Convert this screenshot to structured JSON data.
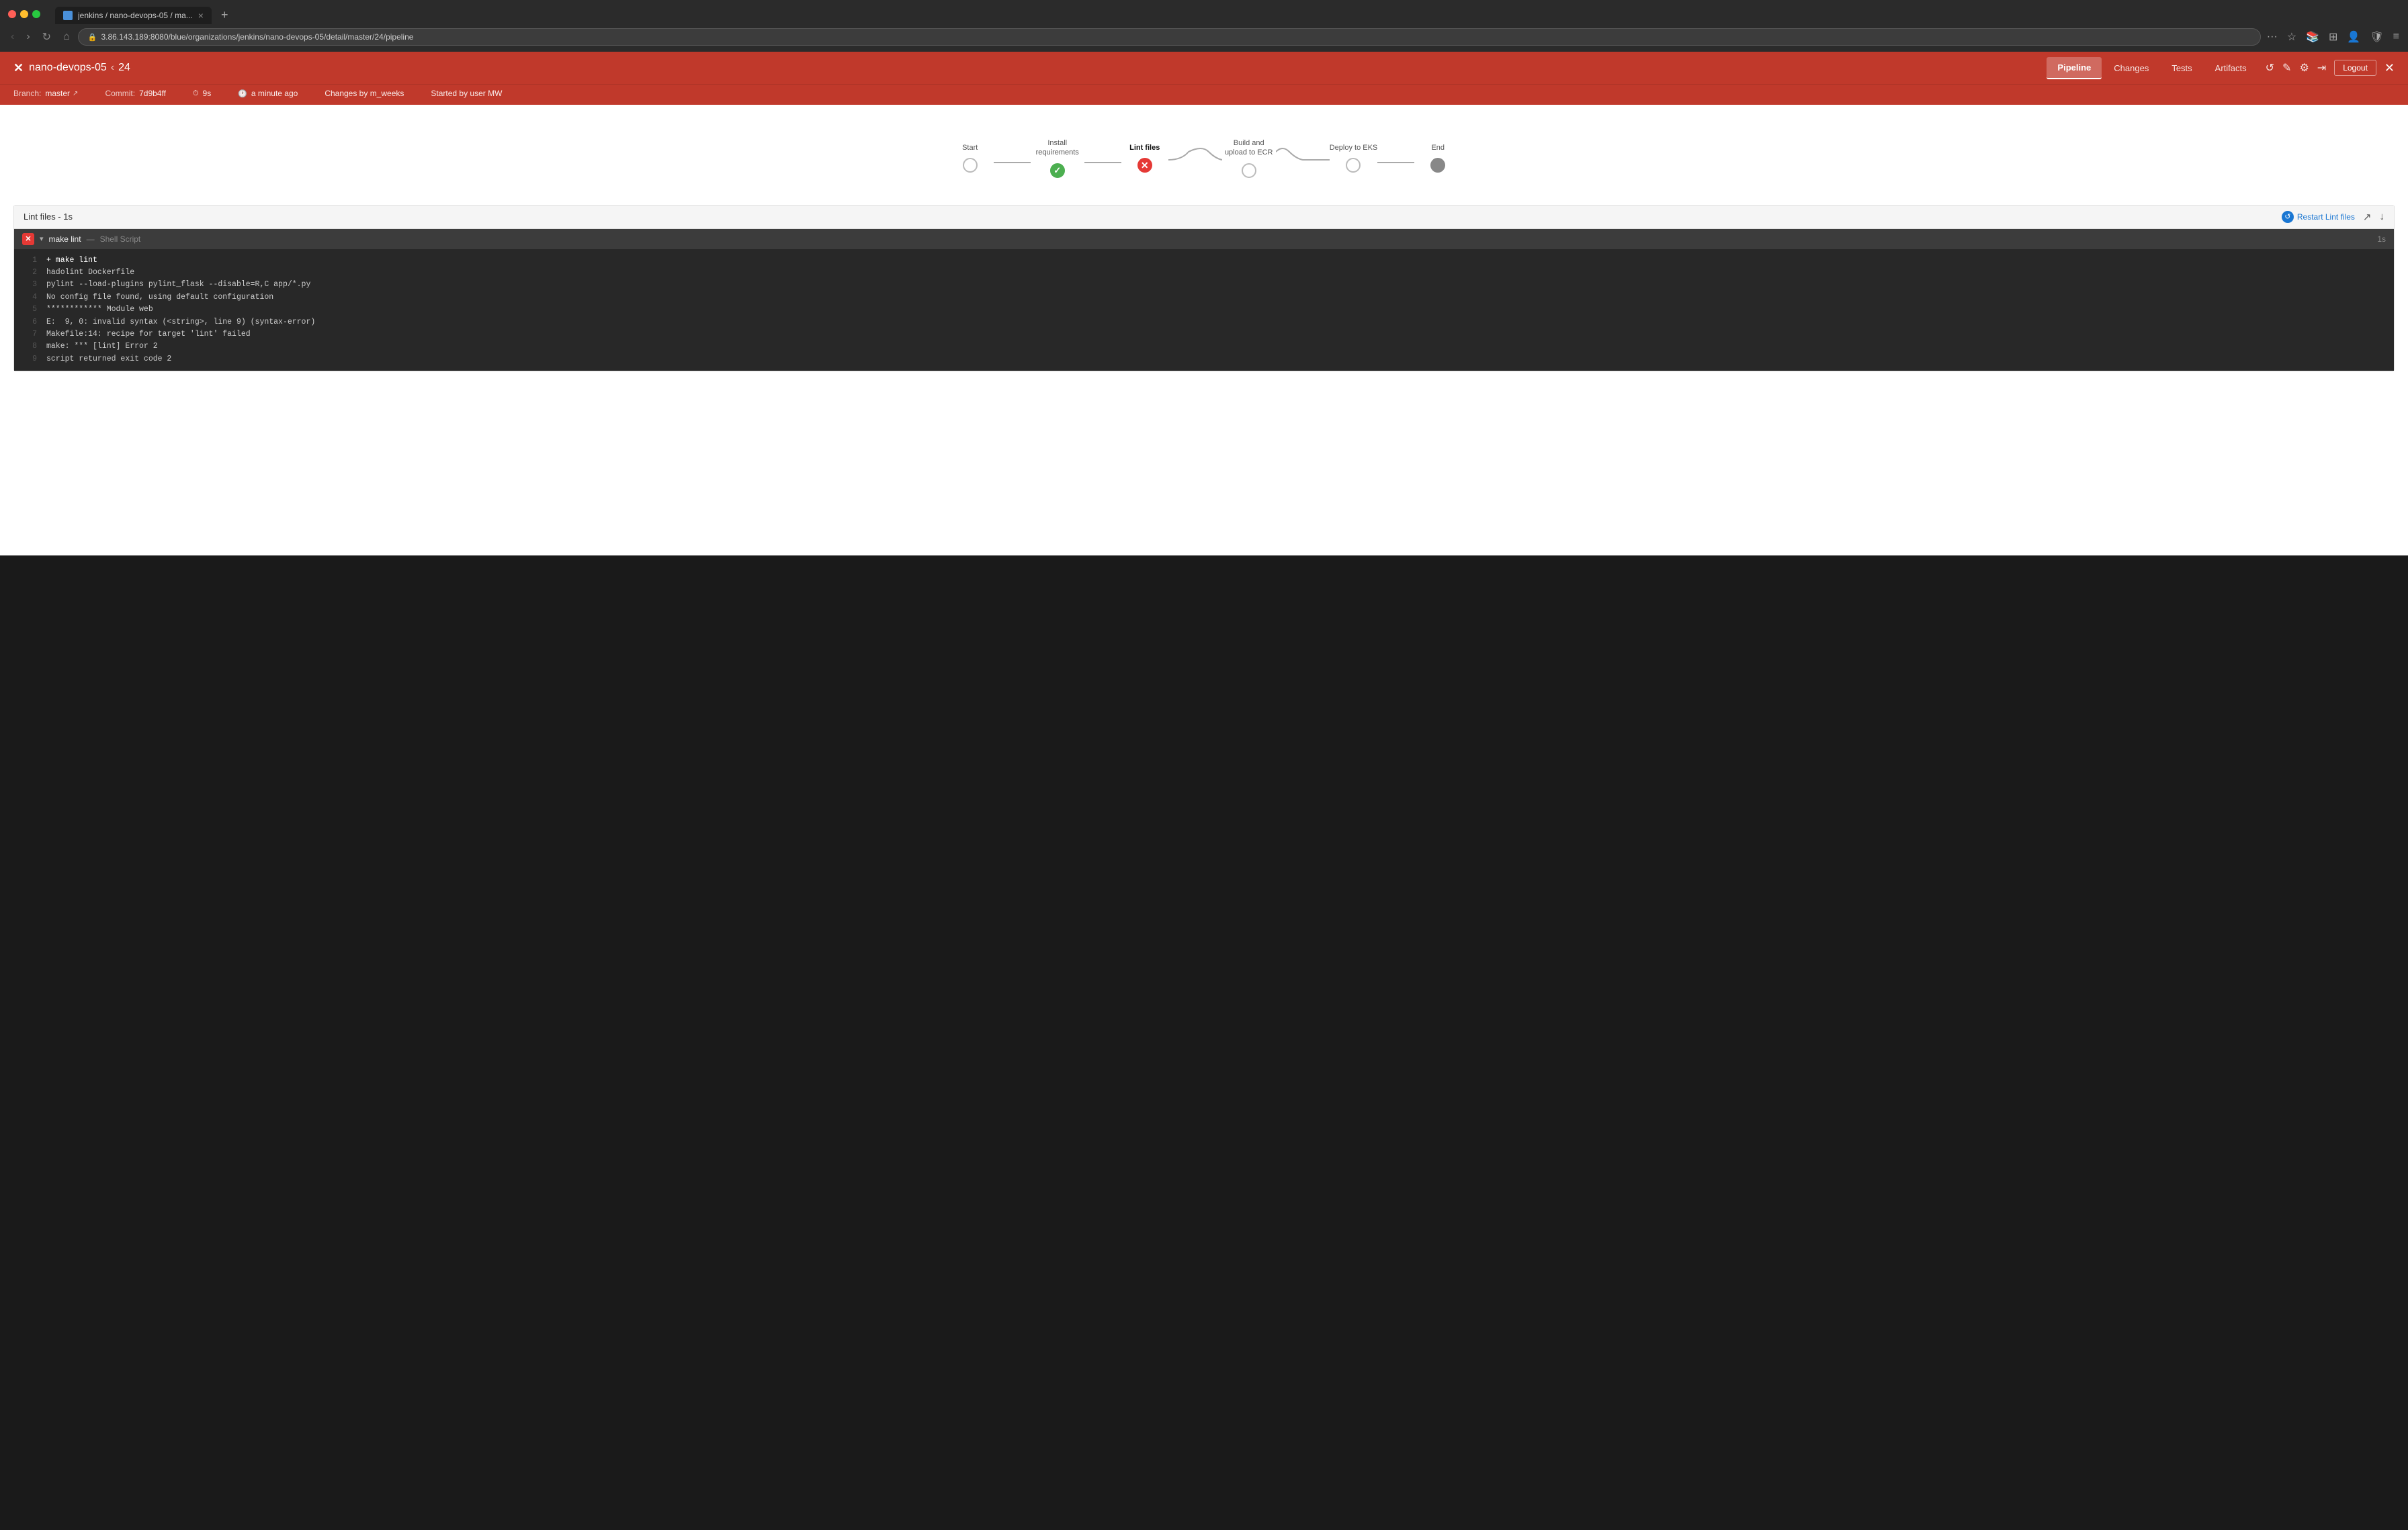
{
  "browser": {
    "tab_title": "jenkins / nano-devops-05 / ma...",
    "address": "3.86.143.189:8080/blue/organizations/jenkins/nano-devops-05/detail/master/24/pipeline",
    "favicon_label": "Jenkins"
  },
  "header": {
    "logo": "✕",
    "project": "nano-devops-05",
    "separator": "‹",
    "build_number": "24",
    "nav_tabs": [
      {
        "id": "pipeline",
        "label": "Pipeline",
        "active": true
      },
      {
        "id": "changes",
        "label": "Changes",
        "active": false
      },
      {
        "id": "tests",
        "label": "Tests",
        "active": false
      },
      {
        "id": "artifacts",
        "label": "Artifacts",
        "active": false
      }
    ],
    "logout_label": "Logout"
  },
  "build_info": {
    "branch_label": "Branch:",
    "branch_value": "master",
    "commit_label": "Commit:",
    "commit_value": "7d9b4ff",
    "duration_value": "9s",
    "time_value": "a minute ago",
    "changes_value": "Changes by m_weeks",
    "started_value": "Started by user MW"
  },
  "pipeline": {
    "stages": [
      {
        "id": "start",
        "label": "Start",
        "status": "pending"
      },
      {
        "id": "install",
        "label": "Install requirements",
        "status": "success"
      },
      {
        "id": "lint",
        "label": "Lint files",
        "status": "failed"
      },
      {
        "id": "build",
        "label": "Build and upload to ECR",
        "status": "pending"
      },
      {
        "id": "deploy",
        "label": "Deploy to EKS",
        "status": "pending"
      },
      {
        "id": "end",
        "label": "End",
        "status": "pending"
      }
    ]
  },
  "log_panel": {
    "title": "Lint files - 1s",
    "restart_label": "Restart Lint files",
    "step": {
      "name": "make lint",
      "type": "Shell Script",
      "time": "1s",
      "status": "error"
    },
    "lines": [
      {
        "num": "1",
        "text": "+ make lint"
      },
      {
        "num": "2",
        "text": "hadolint Dockerfile"
      },
      {
        "num": "3",
        "text": "pylint --load-plugins pylint_flask --disable=R,C app/*.py"
      },
      {
        "num": "4",
        "text": "No config file found, using default configuration"
      },
      {
        "num": "5",
        "text": "************ Module web"
      },
      {
        "num": "6",
        "text": "E:  9, 0: invalid syntax (<string>, line 9) (syntax-error)"
      },
      {
        "num": "7",
        "text": "Makefile:14: recipe for target 'lint' failed"
      },
      {
        "num": "8",
        "text": "make: *** [lint] Error 2"
      },
      {
        "num": "9",
        "text": "script returned exit code 2"
      }
    ]
  },
  "icons": {
    "back": "‹",
    "forward": "›",
    "home": "⌂",
    "reload": "↺",
    "edit": "✎",
    "settings": "⚙",
    "share": "↗",
    "menu": "≡",
    "check": "✓",
    "cross": "✕",
    "expand": "▾",
    "restart": "↺",
    "external": "↗",
    "download": "↓"
  }
}
